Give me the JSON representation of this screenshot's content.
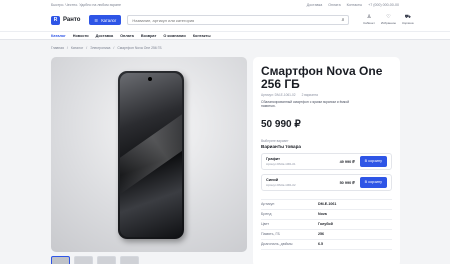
{
  "topbar": {
    "tagline": "Быстро. Честно. Удобно на любом экране",
    "links": [
      "Доставка",
      "Оплата",
      "Контакты",
      "+7 (000) 000-00-00"
    ]
  },
  "header": {
    "logo_letter": "R",
    "logo_text": "Ранто",
    "catalog_label": "Каталог",
    "search_placeholder": "Название, артикул или категория",
    "icons": [
      {
        "name": "user-icon",
        "label": "Кабинет"
      },
      {
        "name": "heart-icon",
        "label": "Избранное"
      },
      {
        "name": "cart-icon",
        "label": "Корзина"
      }
    ]
  },
  "nav": {
    "items": [
      "Каталог",
      "Новости",
      "Доставка",
      "Оплата",
      "Возврат",
      "О компании",
      "Контакты"
    ],
    "active_index": 0
  },
  "breadcrumbs": [
    "Главная",
    "Каталог",
    "Электроника",
    "Смартфон Nova One 256 ГБ"
  ],
  "product": {
    "title": "Смартфон Nova One 256 ГБ",
    "article": "Артикул: DM-E-1061-02",
    "variants_count": "2 варианта",
    "description": "Сбалансированный смартфон с ярким экраном и ёмкой памятью.",
    "price": "50 990 ₽",
    "variant_caption": "Выберите вариант",
    "variant_title": "Варианты товара",
    "variants": [
      {
        "name": "Графит",
        "sku": "Артикул DM-E-1061-01",
        "price": "49 990 ₽",
        "button": "В корзину"
      },
      {
        "name": "Синий",
        "sku": "Артикул DM-E-1061-02",
        "price": "50 990 ₽",
        "button": "В корзину"
      }
    ],
    "specs": [
      {
        "key": "Артикул",
        "value": "DM-E-1061"
      },
      {
        "key": "Бренд",
        "value": "Nova"
      },
      {
        "key": "Цвет",
        "value": "Голубой"
      },
      {
        "key": "Память, ГБ",
        "value": "256"
      },
      {
        "key": "Диагональ, дюймы",
        "value": "6.5"
      }
    ]
  },
  "colors": {
    "accent": "#2e55e6"
  }
}
